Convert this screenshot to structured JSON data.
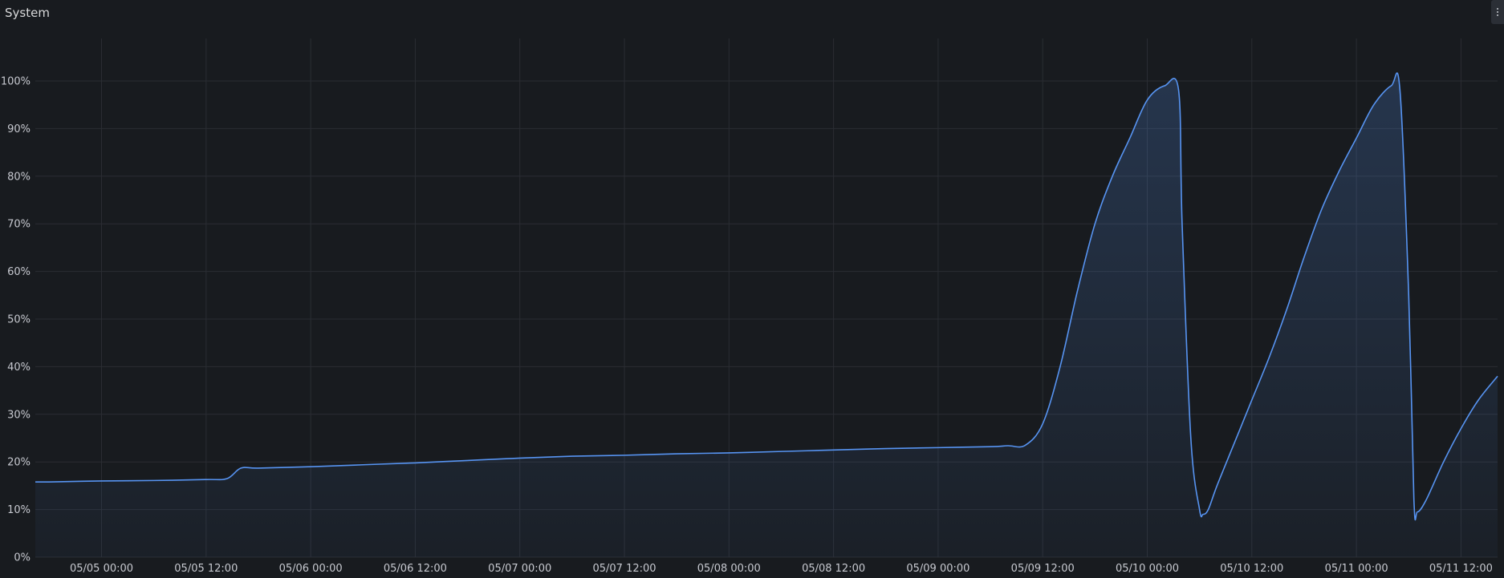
{
  "panel": {
    "title": "System",
    "menu_icon": "vertical-ellipsis-icon"
  },
  "colors": {
    "background": "#181b1f",
    "grid": "#2a2d33",
    "series_line": "#5794f2",
    "series_fill": "#5794f2",
    "axis_text": "#c7c9d0"
  },
  "chart_data": {
    "type": "area",
    "title": "System",
    "xlabel": "",
    "ylabel": "",
    "grid": true,
    "legend": "none",
    "y_ticks": [
      "0%",
      "10%",
      "20%",
      "30%",
      "40%",
      "50%",
      "60%",
      "70%",
      "80%",
      "90%",
      "100%"
    ],
    "ylim": [
      0,
      100
    ],
    "x_ticks": [
      "05/05 00:00",
      "05/05 12:00",
      "05/06 00:00",
      "05/06 12:00",
      "05/07 00:00",
      "05/07 12:00",
      "05/08 00:00",
      "05/08 12:00",
      "05/09 00:00",
      "05/09 12:00",
      "05/10 00:00",
      "05/10 12:00",
      "05/11 00:00",
      "05/11 12:00"
    ],
    "xlim": [
      "05/04 16:24",
      "05/11 16:12"
    ],
    "series": [
      {
        "x": [
          "05/04 16:24",
          "05/04 18:00",
          "05/05 00:00",
          "05/05 06:00",
          "05/05 12:00",
          "05/05 14:24",
          "05/05 16:00",
          "05/05 18:00",
          "05/06 00:00",
          "05/06 06:00",
          "05/06 12:00",
          "05/06 18:00",
          "05/07 00:00",
          "05/07 06:00",
          "05/07 12:00",
          "05/07 18:00",
          "05/08 00:00",
          "05/08 06:00",
          "05/08 12:00",
          "05/08 18:00",
          "05/09 00:00",
          "05/09 06:00",
          "05/09 08:00",
          "05/09 10:00",
          "05/09 12:00",
          "05/09 14:00",
          "05/09 16:00",
          "05/09 18:00",
          "05/09 20:00",
          "05/09 22:00",
          "05/10 00:00",
          "05/10 02:00",
          "05/10 03:36",
          "05/10 04:00",
          "05/10 05:00",
          "05/10 06:00",
          "05/10 06:24",
          "05/10 07:00",
          "05/10 08:00",
          "05/10 10:00",
          "05/10 12:00",
          "05/10 14:00",
          "05/10 16:00",
          "05/10 18:00",
          "05/10 20:00",
          "05/10 22:00",
          "05/11 00:00",
          "05/11 02:00",
          "05/11 04:00",
          "05/11 05:00",
          "05/11 06:00",
          "05/11 06:36",
          "05/11 07:00",
          "05/11 08:00",
          "05/11 10:00",
          "05/11 12:00",
          "05/11 14:00",
          "05/11 16:12"
        ],
        "y": [
          15.8,
          15.8,
          16,
          16.1,
          16.3,
          16.5,
          18.7,
          18.7,
          19,
          19.4,
          19.8,
          20.3,
          20.8,
          21.2,
          21.4,
          21.7,
          21.9,
          22.2,
          22.5,
          22.8,
          23,
          23.2,
          23.4,
          23.5,
          28,
          40,
          56,
          70,
          80,
          88,
          96,
          99,
          98,
          70,
          25,
          10,
          9,
          10,
          15,
          24,
          33,
          42,
          52,
          63,
          73,
          81,
          88,
          95,
          99,
          98,
          55,
          12,
          9.5,
          12,
          20,
          27,
          33,
          38
        ]
      }
    ]
  }
}
